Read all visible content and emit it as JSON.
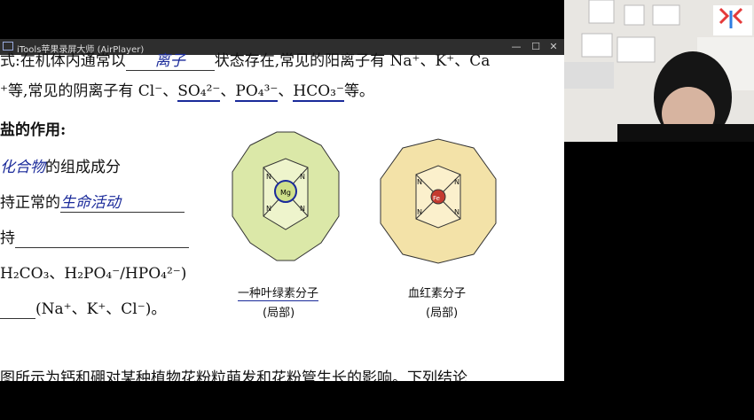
{
  "window": {
    "title": "iTools苹果录屏大师 (AirPlayer)"
  },
  "doc": {
    "line1": {
      "pre": "式:在机体内通常以",
      "hw": "离子",
      "post": "状态存在,常见的阳离子有 Na⁺、K⁺、Ca"
    },
    "line2": {
      "pre": "⁺等,常见的阴离子有 Cl⁻、",
      "so4": "SO₄²⁻",
      "sep1": "、",
      "po4": "PO₄³⁻",
      "sep2": "、",
      "hco3": "HCO₃⁻",
      "post": "等。"
    },
    "heading": "盐的作用:",
    "item1": {
      "hw": "化合物",
      "text": "的组成成分"
    },
    "item2": {
      "pre": "持正常的",
      "hw": "生命活动"
    },
    "item3": {
      "pre": "持"
    },
    "item4": {
      "text": "H₂CO₃、H₂PO₄⁻/HPO₄²⁻)"
    },
    "item5": {
      "text": "(Na⁺、K⁺、Cl⁻)。"
    },
    "bottom": "图所示为钙和硼对某种植物花粉粒萌发和花粉管生长的影响。下列结论"
  },
  "figures": {
    "chlorophyll": {
      "label": "一种叶绿素分子",
      "sub": "(局部)",
      "center": "Mg",
      "n": "N"
    },
    "heme": {
      "label": "血红素分子",
      "sub": "(局部)",
      "center": "Fe",
      "n": "N"
    }
  },
  "colors": {
    "hand": "#1a2a9a",
    "ring_fill": "#dbe8a8",
    "heme_fill": "#f3e2a8",
    "fe": "#c43a2f"
  }
}
